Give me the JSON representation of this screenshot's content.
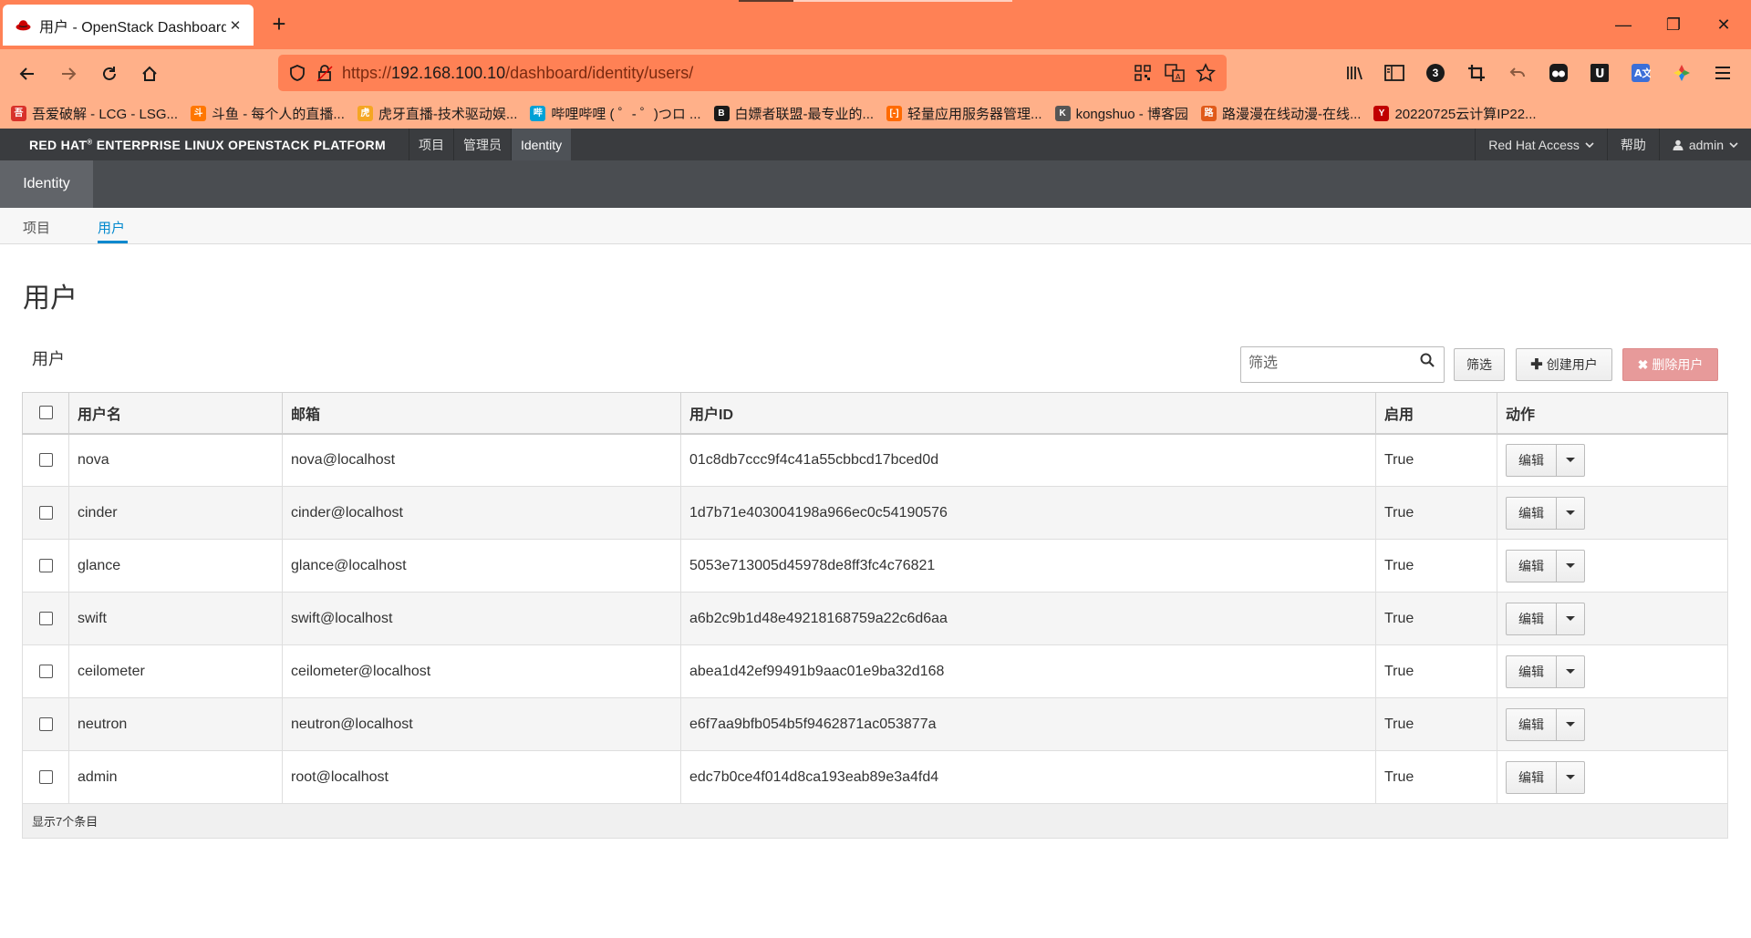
{
  "browser": {
    "tab_title": "用户 - OpenStack Dashboard",
    "tab_close": "✕",
    "new_tab": "+",
    "window_controls": {
      "minimize": "—",
      "restore": "❐",
      "close": "✕"
    },
    "url": {
      "scheme": "https://",
      "host": "192.168.100.10",
      "path": "/dashboard/identity/users/"
    },
    "extension_badge": "3",
    "bookmarks": [
      {
        "label": "吾爱破解 - LCG - LSG...",
        "icon": "52pojie-icon",
        "color": "#d8322b",
        "glyph": "吾"
      },
      {
        "label": "斗鱼 - 每个人的直播...",
        "icon": "douyu-icon",
        "color": "#ff7700",
        "glyph": "斗"
      },
      {
        "label": "虎牙直播-技术驱动娱...",
        "icon": "huya-icon",
        "color": "#f5a623",
        "glyph": "虎"
      },
      {
        "label": "哔哩哔哩 ( ゜- ゜)つロ ...",
        "icon": "bilibili-icon",
        "color": "#00a1d6",
        "glyph": "哔"
      },
      {
        "label": "白嫖者联盟-最专业的...",
        "icon": "baipiao-icon",
        "color": "#1a1a1a",
        "glyph": "B"
      },
      {
        "label": "轻量应用服务器管理...",
        "icon": "aliyun-icon",
        "color": "#ff6a00",
        "glyph": "[-]"
      },
      {
        "label": "kongshuo - 博客园",
        "icon": "cnblogs-icon",
        "color": "#555555",
        "glyph": "K"
      },
      {
        "label": "路漫漫在线动漫-在线...",
        "icon": "lumanman-icon",
        "color": "#e05a1a",
        "glyph": "路"
      },
      {
        "label": "20220725云计算IP22...",
        "icon": "doc-icon",
        "color": "#c00000",
        "glyph": "Y"
      }
    ]
  },
  "header": {
    "brand": "RED HAT",
    "brand_rest": "ENTERPRISE LINUX OPENSTACK PLATFORM",
    "nav": [
      "项目",
      "管理员",
      "Identity"
    ],
    "right": {
      "access": "Red Hat Access",
      "help": "帮助",
      "user": "admin"
    }
  },
  "panel": {
    "active": "Identity"
  },
  "subtabs": [
    "项目",
    "用户"
  ],
  "page": {
    "title": "用户",
    "table_title": "用户",
    "filter_placeholder": "筛选",
    "filter_button": "筛选",
    "create_button": "创建用户",
    "delete_button": "删除用户"
  },
  "table": {
    "columns": [
      "用户名",
      "邮箱",
      "用户ID",
      "启用",
      "动作"
    ],
    "rows": [
      {
        "name": "nova",
        "email": "nova@localhost",
        "id": "01c8db7ccc9f4c41a55cbbcd17bced0d",
        "enabled": "True",
        "action": "编辑"
      },
      {
        "name": "cinder",
        "email": "cinder@localhost",
        "id": "1d7b71e403004198a966ec0c54190576",
        "enabled": "True",
        "action": "编辑"
      },
      {
        "name": "glance",
        "email": "glance@localhost",
        "id": "5053e713005d45978de8ff3fc4c76821",
        "enabled": "True",
        "action": "编辑"
      },
      {
        "name": "swift",
        "email": "swift@localhost",
        "id": "a6b2c9b1d48e49218168759a22c6d6aa",
        "enabled": "True",
        "action": "编辑"
      },
      {
        "name": "ceilometer",
        "email": "ceilometer@localhost",
        "id": "abea1d42ef99491b9aac01e9ba32d168",
        "enabled": "True",
        "action": "编辑"
      },
      {
        "name": "neutron",
        "email": "neutron@localhost",
        "id": "e6f7aa9bfb054b5f9462871ac053877a",
        "enabled": "True",
        "action": "编辑"
      },
      {
        "name": "admin",
        "email": "root@localhost",
        "id": "edc7b0ce4f014d8ca193eab89e3a4fd4",
        "enabled": "True",
        "action": "编辑"
      }
    ],
    "footer": "显示7个条目"
  },
  "colors": {
    "browser_tabbar": "#ff8155",
    "browser_toolbar": "#ffb089",
    "os_header": "#3a3c3f",
    "accent": "#0088ce",
    "danger": "#e79a9a"
  }
}
